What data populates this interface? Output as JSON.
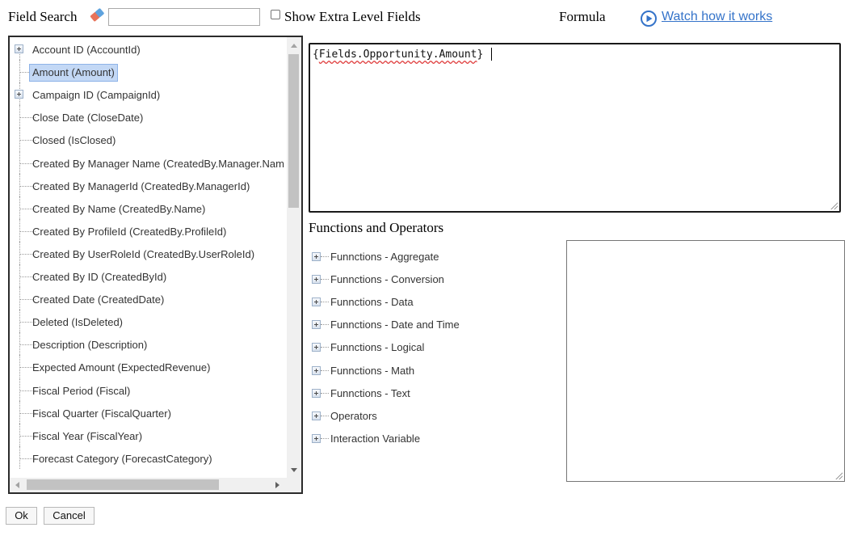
{
  "header": {
    "field_search_label": "Field Search",
    "search_value": "",
    "extra_fields_label": "Show Extra Level Fields",
    "extra_fields_checked": false,
    "formula_label": "Formula",
    "watch_link": "Watch how it works"
  },
  "field_tree": {
    "items": [
      {
        "label": "Account ID (AccountId)",
        "expandable": true
      },
      {
        "label": "Amount (Amount)",
        "selected": true
      },
      {
        "label": "Campaign ID (CampaignId)",
        "expandable": true
      },
      {
        "label": "Close Date (CloseDate)"
      },
      {
        "label": "Closed (IsClosed)"
      },
      {
        "label": "Created By Manager Name (CreatedBy.Manager.Nam"
      },
      {
        "label": "Created By ManagerId (CreatedBy.ManagerId)"
      },
      {
        "label": "Created By Name (CreatedBy.Name)"
      },
      {
        "label": "Created By ProfileId (CreatedBy.ProfileId)"
      },
      {
        "label": "Created By UserRoleId (CreatedBy.UserRoleId)"
      },
      {
        "label": "Created By ID (CreatedById)"
      },
      {
        "label": "Created Date (CreatedDate)"
      },
      {
        "label": "Deleted (IsDeleted)"
      },
      {
        "label": "Description (Description)"
      },
      {
        "label": "Expected Amount (ExpectedRevenue)"
      },
      {
        "label": "Fiscal Period (Fiscal)"
      },
      {
        "label": "Fiscal Quarter (FiscalQuarter)"
      },
      {
        "label": "Fiscal Year (FiscalYear)"
      },
      {
        "label": "Forecast Category (ForecastCategory)"
      }
    ]
  },
  "formula": {
    "prefix": "{",
    "expression": "Fields.Opportunity.Amount",
    "suffix": "}"
  },
  "functions": {
    "heading": "Functions and Operators",
    "items": [
      "Funnctions - Aggregate",
      "Funnctions - Conversion",
      "Funnctions - Data",
      "Funnctions - Date and Time",
      "Funnctions - Logical",
      "Funnctions - Math",
      "Funnctions - Text",
      "Operators",
      "Interaction Variable"
    ]
  },
  "description": "",
  "buttons": {
    "ok": "Ok",
    "cancel": "Cancel"
  },
  "colors": {
    "link": "#3473c9",
    "selection": "#c3d8f5",
    "eraser": "#e8735a"
  }
}
